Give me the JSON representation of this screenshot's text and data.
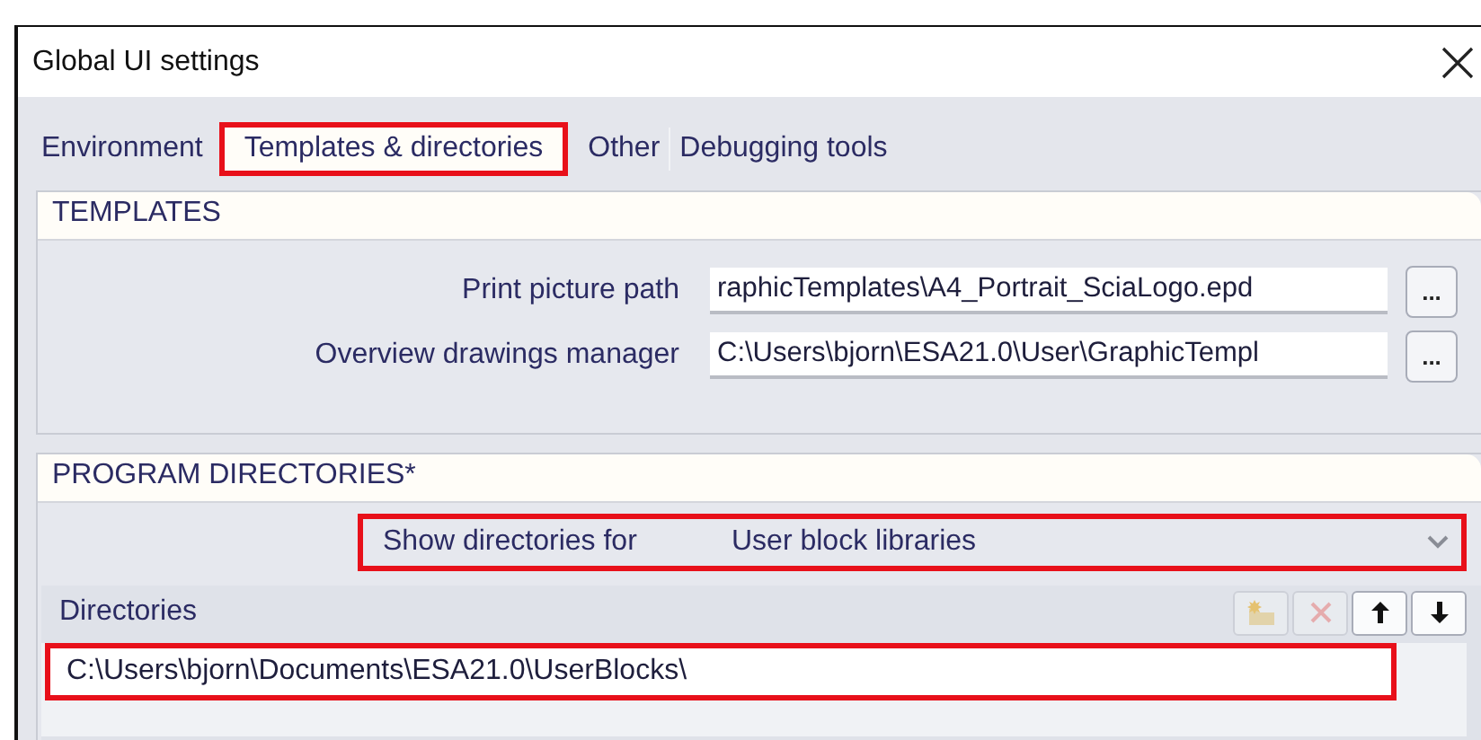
{
  "window": {
    "title": "Global UI settings"
  },
  "tabs": [
    {
      "label": "Environment",
      "selected": false,
      "highlighted": false
    },
    {
      "label": "Templates & directories",
      "selected": true,
      "highlighted": true
    },
    {
      "label": "Other",
      "selected": false,
      "highlighted": false
    },
    {
      "label": "Debugging tools",
      "selected": false,
      "highlighted": false
    }
  ],
  "templates": {
    "title": "TEMPLATES",
    "rows": [
      {
        "label": "Print picture path",
        "value": "raphicTemplates\\A4_Portrait_SciaLogo.epd",
        "button": "..."
      },
      {
        "label": "Overview drawings manager",
        "value": "C:\\Users\\bjorn\\ESA21.0\\User\\GraphicTempl",
        "button": "..."
      }
    ]
  },
  "program_directories": {
    "title": "PROGRAM DIRECTORIES*",
    "show_for": {
      "label": "Show directories for",
      "value": "User block libraries",
      "highlighted": true
    },
    "directories": {
      "title": "Directories",
      "tools": [
        {
          "kind": "new-folder",
          "disabled": true
        },
        {
          "kind": "delete",
          "disabled": true
        },
        {
          "kind": "up",
          "disabled": false
        },
        {
          "kind": "down",
          "disabled": false
        }
      ],
      "items": [
        {
          "path": "C:\\Users\\bjorn\\Documents\\ESA21.0\\UserBlocks\\",
          "highlighted": true
        }
      ]
    }
  }
}
